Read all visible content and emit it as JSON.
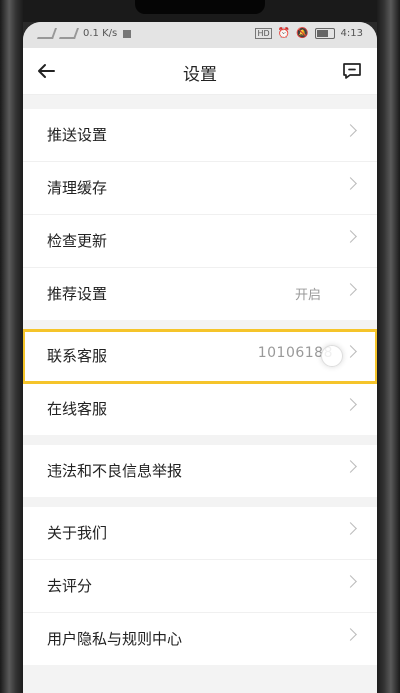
{
  "status_bar": {
    "left_text": "⁴⁶ ⁴ᴳ",
    "speed": "0.1 K/s",
    "time": "4:13"
  },
  "header": {
    "title": "设置",
    "back_icon": "arrow-left-icon",
    "feedback_icon": "message-square-icon"
  },
  "groups": [
    {
      "items": [
        {
          "label": "推送设置",
          "value": ""
        },
        {
          "label": "清理缓存",
          "value": ""
        },
        {
          "label": "检查更新",
          "value": ""
        },
        {
          "label": "推荐设置",
          "value": "开启"
        }
      ]
    },
    {
      "items": [
        {
          "label": "联系客服",
          "value": "10106188"
        },
        {
          "label": "在线客服",
          "value": ""
        }
      ]
    },
    {
      "items": [
        {
          "label": "违法和不良信息举报",
          "value": ""
        }
      ]
    },
    {
      "items": [
        {
          "label": "关于我们",
          "value": ""
        },
        {
          "label": "去评分",
          "value": ""
        },
        {
          "label": "用户隐私与规则中心",
          "value": ""
        }
      ]
    }
  ],
  "colors": {
    "highlight": "#f5c42a",
    "background": "#f3f3f3"
  }
}
